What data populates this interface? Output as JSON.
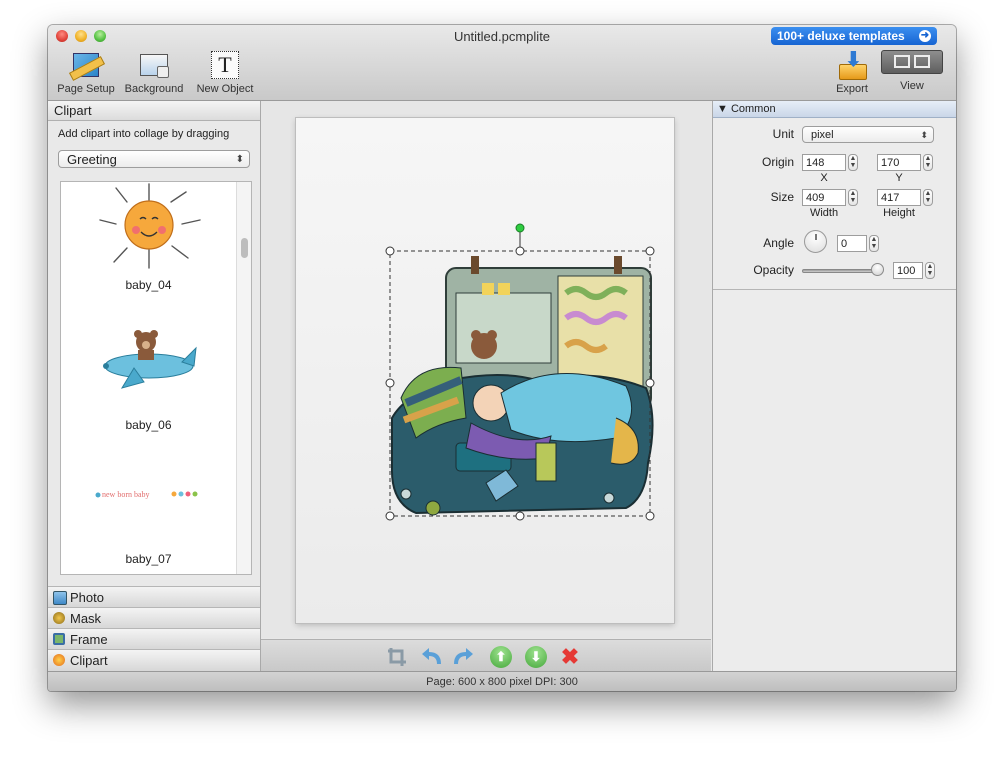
{
  "window": {
    "title": "Untitled.pcmplite"
  },
  "promo": {
    "label": "100+ deluxe templates"
  },
  "toolbar": {
    "page_setup": "Page Setup",
    "background": "Background",
    "new_object": "New Object",
    "export": "Export",
    "view": "View"
  },
  "left_panel": {
    "header": "Clipart",
    "hint": "Add clipart into collage by dragging",
    "category": "Greeting",
    "items": [
      {
        "name": "baby_04",
        "icon": "sun-clipart"
      },
      {
        "name": "baby_06",
        "icon": "airplane-bear-clipart"
      },
      {
        "name": "baby_07",
        "icon": "text-banner-clipart"
      }
    ],
    "sections": [
      "Photo",
      "Mask",
      "Frame",
      "Clipart"
    ]
  },
  "inspector": {
    "header": "Common",
    "unit_label": "Unit",
    "unit_value": "pixel",
    "origin_label": "Origin",
    "origin_x": "148",
    "origin_y": "170",
    "x_label": "X",
    "y_label": "Y",
    "size_label": "Size",
    "width": "409",
    "height": "417",
    "width_label": "Width",
    "height_label": "Height",
    "angle_label": "Angle",
    "angle_value": "0",
    "opacity_label": "Opacity",
    "opacity_value": "100"
  },
  "bottom_tools": [
    "crop-icon",
    "undo-icon",
    "redo-icon",
    "move-up-icon",
    "move-down-icon",
    "delete-icon"
  ],
  "status": {
    "text": "Page: 600 x 800 pixel DPI: 300"
  },
  "colors": {
    "accent_blue": "#1664d2",
    "selection_handle_green": "#2ecc40",
    "delete_red": "#e53935",
    "move_green": "#5cbf57"
  }
}
